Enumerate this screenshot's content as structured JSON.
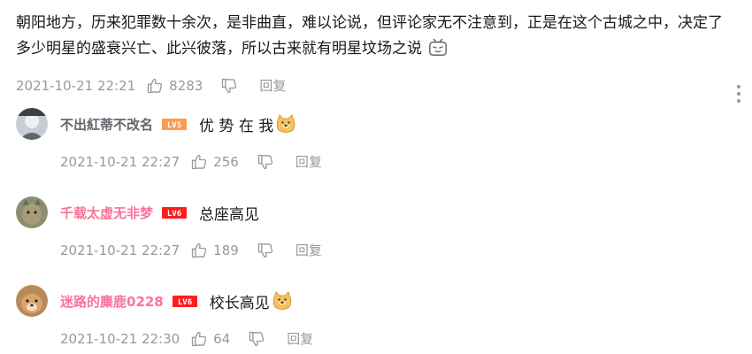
{
  "main_comment": {
    "text": "朝阳地方，历来犯罪数十余次，是非曲直，难以论说，但评论家无不注意到，正是在这个古城之中，决定了多少明星的盛衰兴亡、此兴彼落，所以古来就有明星坟场之说",
    "time": "2021-10-21 22:21",
    "likes": "8283",
    "reply_label": "回复"
  },
  "replies": [
    {
      "username": "不出紅蒂不改名",
      "username_color": "#61666d",
      "level_badge": "LV5",
      "level_color": "#ff9a4c",
      "text": "优 势 在 我",
      "has_emoji": true,
      "time": "2021-10-21 22:27",
      "likes": "256",
      "reply_label": "回复"
    },
    {
      "username": "千载太虚无非梦",
      "username_color": "#fb7299",
      "level_badge": "LV6",
      "level_color": "#ff1c1c",
      "text": "总座高见",
      "has_emoji": false,
      "time": "2021-10-21 22:27",
      "likes": "189",
      "reply_label": "回复"
    },
    {
      "username": "迷路的麋鹿0228",
      "username_color": "#fb7299",
      "level_badge": "LV6",
      "level_color": "#ff1c1c",
      "text": "校长高见",
      "has_emoji": true,
      "time": "2021-10-21 22:30",
      "likes": "64",
      "reply_label": "回复"
    }
  ],
  "icons": {
    "like": "thumbs-up-icon",
    "dislike": "thumbs-down-icon",
    "more": "more-vertical-icon",
    "emoji_main": "tv-face-emoji-icon",
    "emoji_reply": "doge-emoji-icon"
  }
}
